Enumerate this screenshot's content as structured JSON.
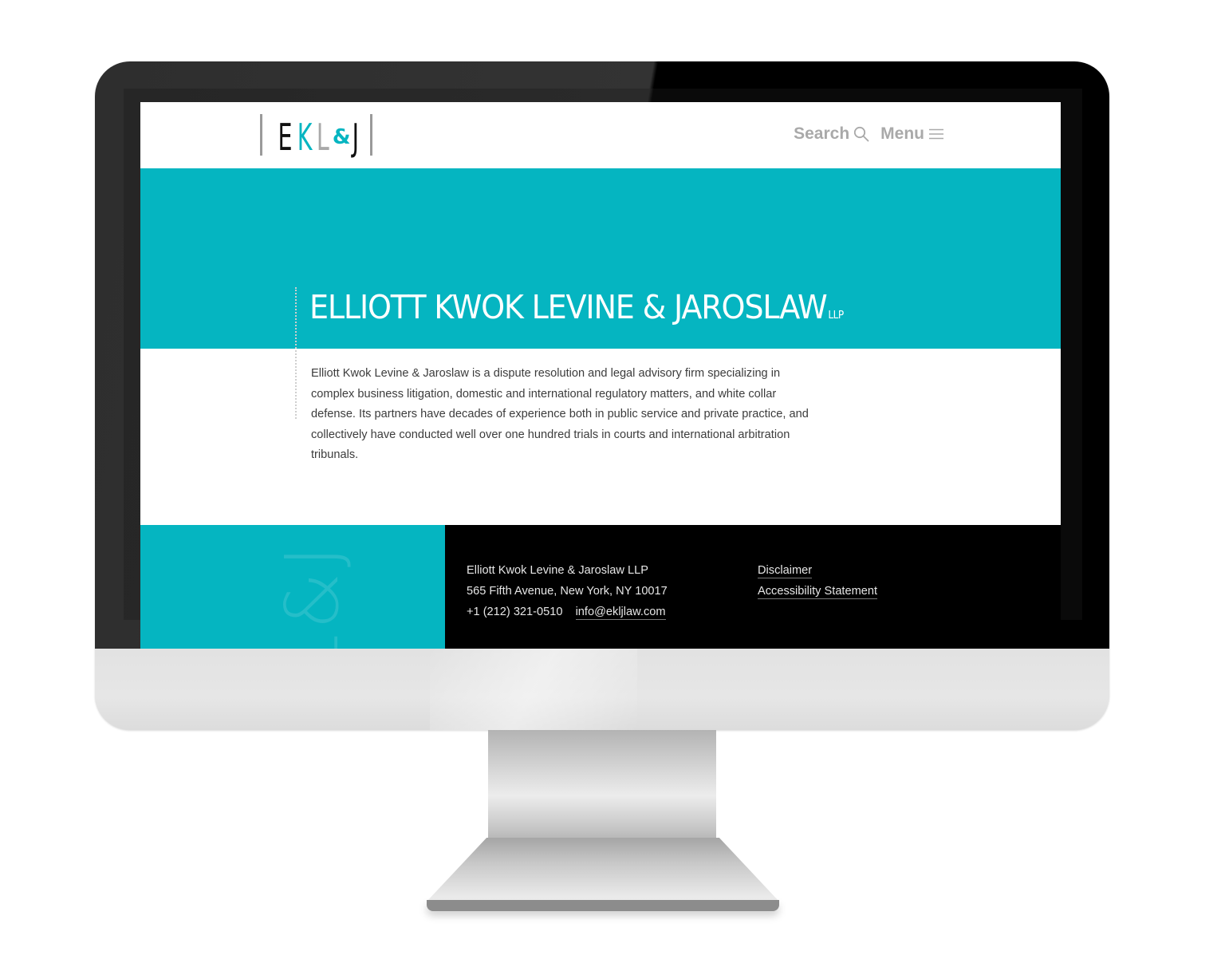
{
  "header": {
    "logo": {
      "letters": [
        {
          "char": "E",
          "color": "#111111"
        },
        {
          "char": "K",
          "color": "#05b5c1"
        },
        {
          "char": "L",
          "color": "#a9a9a9"
        },
        {
          "char": "&",
          "color": "#05b5c1"
        },
        {
          "char": "J",
          "color": "#111111"
        }
      ]
    },
    "nav": {
      "search_label": "Search",
      "search_icon": "search-icon",
      "menu_label": "Menu",
      "menu_icon": "hamburger-menu-icon"
    }
  },
  "hero": {
    "title": "ELLIOTT KWOK LEVINE & JAROSLAW",
    "suffix": "LLP"
  },
  "intro": {
    "text": "Elliott Kwok Levine & Jaroslaw is a dispute resolution and legal advisory firm specializing in complex business litigation, domestic and international regulatory matters, and white collar defense. Its partners have decades of experience both in public service and private practice, and collectively have conducted well over one hundred trials in courts and international arbitration tribunals."
  },
  "footer": {
    "watermark": "EKL&J",
    "firm_name": "Elliott Kwok Levine & Jaroslaw LLP",
    "address": "565 Fifth Avenue, New York, NY 10017",
    "phone": "+1 (212) 321-0510",
    "email": "info@ekljlaw.com",
    "links": [
      "Disclaimer",
      "Accessibility Statement"
    ]
  },
  "colors": {
    "brand_teal": "#05b5c1",
    "footer_black": "#000000",
    "nav_gray": "#a9a9a9"
  }
}
